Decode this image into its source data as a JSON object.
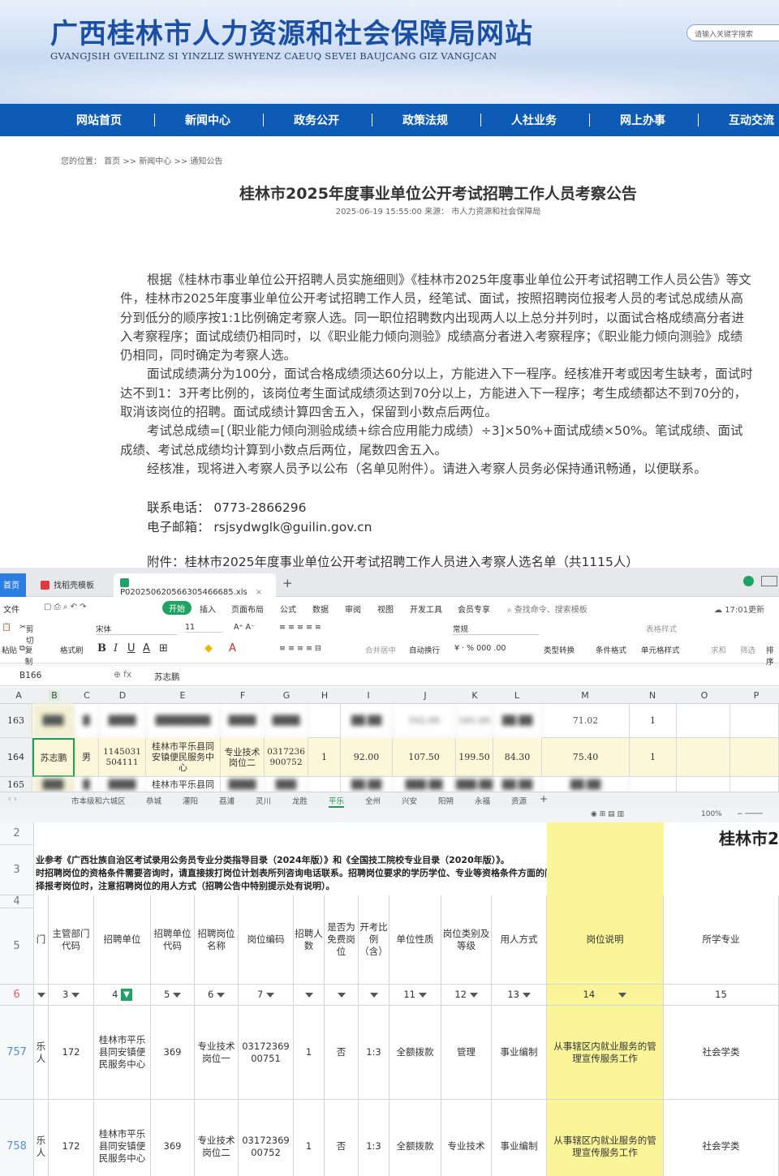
{
  "site": {
    "title": "广西桂林市人力资源和社会保障局网站",
    "subtitle": "GVANGJSIH GVEILINZ SI YINZLIZ SWHYENZ CAEUQ SEVEI BAUJCANG GIZ VANGJCAN",
    "search_placeholder": "请输入关键字搜索"
  },
  "nav": [
    "网站首页",
    "新闻中心",
    "政务公开",
    "政策法规",
    "人社业务",
    "网上办事",
    "互动交流"
  ],
  "breadcrumb": "您的位置： 首页 >> 新闻中心 >> 通知公告",
  "article": {
    "title": "桂林市2025年度事业单位公开考试招聘工作人员考察公告",
    "meta": "2025-06-19 15:55:00    来源： 市人力资源和社会保障局",
    "paragraphs": [
      "根据《桂林市事业单位公开招聘人员实施细则》《桂林市2025年度事业单位公开考试招聘工作人员公告》等文件，桂林市2025年度事业单位公开考试招聘工作人员，经笔试、面试，按照招聘岗位报考人员的考试总成绩从高分到低分的顺序按1:1比例确定考察人选。同一职位招聘数内出现两人以上总分并列时，以面试合格成绩高分者进入考察程序；面试成绩仍相同时，以《职业能力倾向测验》成绩高分者进入考察程序；《职业能力倾向测验》成绩仍相同，同时确定为考察人选。",
      "面试成绩满分为100分，面试合格成绩须达60分以上，方能进入下一程序。经核准开考或因考生缺考，面试时达不到1：3开考比例的，该岗位考生面试成绩须达到70分以上，方能进入下一程序；考生成绩都达不到70分的，取消该岗位的招聘。面试成绩计算四舍五入，保留到小数点后两位。",
      "考试总成绩=[（职业能力倾向测验成绩+综合应用能力成绩）÷3]×50%+面试成绩×50%。笔试成绩、面试成绩、考试总成绩均计算到小数点后两位，尾数四舍五入。",
      "经核准，现将进入考察人员予以公布（名单见附件）。请进入考察人员务必保持通讯畅通，以便联系。"
    ],
    "phone": "联系电话：  0773-2866296",
    "email": "电子邮箱：  rsjsydwglk@guilin.gov.cn",
    "attachment": "附件：桂林市2025年度事业单位公开考试招聘工作人员进入考察人选名单（共1115人）"
  },
  "sheet1": {
    "tabs": [
      "首页",
      "找稻壳模板",
      "P020250620566305466685.xls"
    ],
    "menus": [
      "文件",
      "开始",
      "插入",
      "页面布局",
      "公式",
      "数据",
      "审阅",
      "视图",
      "开发工具",
      "会员专享"
    ],
    "search_hint": "查找命令、搜索模板",
    "update_time": "17:01更新",
    "ribbon": {
      "paste": "粘贴",
      "cut": "剪切",
      "copy": "复制",
      "format_painter": "格式刷",
      "font": "宋体",
      "font_size": "11",
      "merge": "合并居中",
      "wrap": "自动换行",
      "number_format": "常规",
      "convert": "类型转换",
      "cond_format": "条件格式",
      "table_style": "表格样式",
      "cell_style": "单元格样式",
      "sum": "求和",
      "filter": "筛选",
      "sort": "排序"
    },
    "cell_ref": "B166",
    "formula_value": "苏志鹏",
    "columns": [
      "A",
      "B",
      "C",
      "D",
      "E",
      "F",
      "G",
      "H",
      "I",
      "J",
      "K",
      "L",
      "M",
      "N",
      "O",
      "P"
    ],
    "row163": {
      "num": "163",
      "j": "102.00",
      "k": "181.00",
      "m": "71.02",
      "n": "1"
    },
    "row164": {
      "num": "164",
      "name": "苏志鹏",
      "gender": "男",
      "unit_code": "1145031504111",
      "unit": "桂林市平乐县同安镇便民服务中心",
      "post": "专业技术岗位二",
      "post_code": "0317236900752",
      "recruit": "1",
      "written": "92.00",
      "comp": "107.50",
      "total_written": "199.50",
      "interview": "84.30",
      "total": "75.40",
      "rank": "1"
    },
    "row165": {
      "num": "165",
      "unit": "桂林市平乐县同"
    },
    "sheet_tabs": [
      "市本级和六城区",
      "恭城",
      "灌阳",
      "荔浦",
      "灵川",
      "龙胜",
      "平乐",
      "全州",
      "兴安",
      "阳朔",
      "永福",
      "资源"
    ],
    "active_sheet": "平乐",
    "zoom": "100%"
  },
  "sheet2": {
    "title_fragment": "桂林市2",
    "note1": "业参考《广西壮族自治区考试录用公务员专业分类指导目录（2024年版）》和《全国技工院校专业目录（2020年版）》。",
    "note2": "时招聘岗位的资格条件需要咨询时，请直接拨打岗位计划表所列咨询电话联系。招聘岗位要求的学历学位、专业等资格条件方面的问题，由招聘单位负责解释。",
    "note3": "择报考岗位时，注意招聘岗位的用人方式（招聘公告中特别提示处有说明）。",
    "headers": [
      "门",
      "主管部门代码",
      "招聘单位",
      "招聘单位代码",
      "招聘岗位名称",
      "岗位编码",
      "招聘人数",
      "是否为免费岗位",
      "开考比例（含）",
      "单位性质",
      "岗位类别及等级",
      "用人方式",
      "岗位说明",
      "所学专业"
    ],
    "col_numbers": [
      "",
      "3",
      "4",
      "5",
      "6",
      "7",
      "",
      "",
      "",
      "11",
      "12",
      "13",
      "14",
      "15"
    ],
    "rows": [
      {
        "num": "757",
        "dept": "乐人",
        "dept_code": "172",
        "unit": "桂林市平乐县同安镇便民服务中心",
        "unit_code": "369",
        "post": "专业技术岗位一",
        "post_code": "0317236900751",
        "count": "1",
        "free": "否",
        "ratio": "1:3",
        "nature": "全额拨款",
        "category": "管理",
        "hire": "事业编制",
        "desc": "从事辖区内就业服务的管理宣传服务工作",
        "major": "社会学类"
      },
      {
        "num": "758",
        "dept": "乐人",
        "dept_code": "172",
        "unit": "桂林市平乐县同安镇便民服务中心",
        "unit_code": "369",
        "post": "专业技术岗位二",
        "post_code": "0317236900752",
        "count": "1",
        "free": "否",
        "ratio": "1:3",
        "nature": "全额拨款",
        "category": "专业技术",
        "hire": "事业编制",
        "desc": "从事辖区内就业服务的管理宣传服务工作",
        "major": "社会学类"
      }
    ],
    "row_labels": [
      "2",
      "3",
      "4",
      "5",
      "6"
    ]
  }
}
